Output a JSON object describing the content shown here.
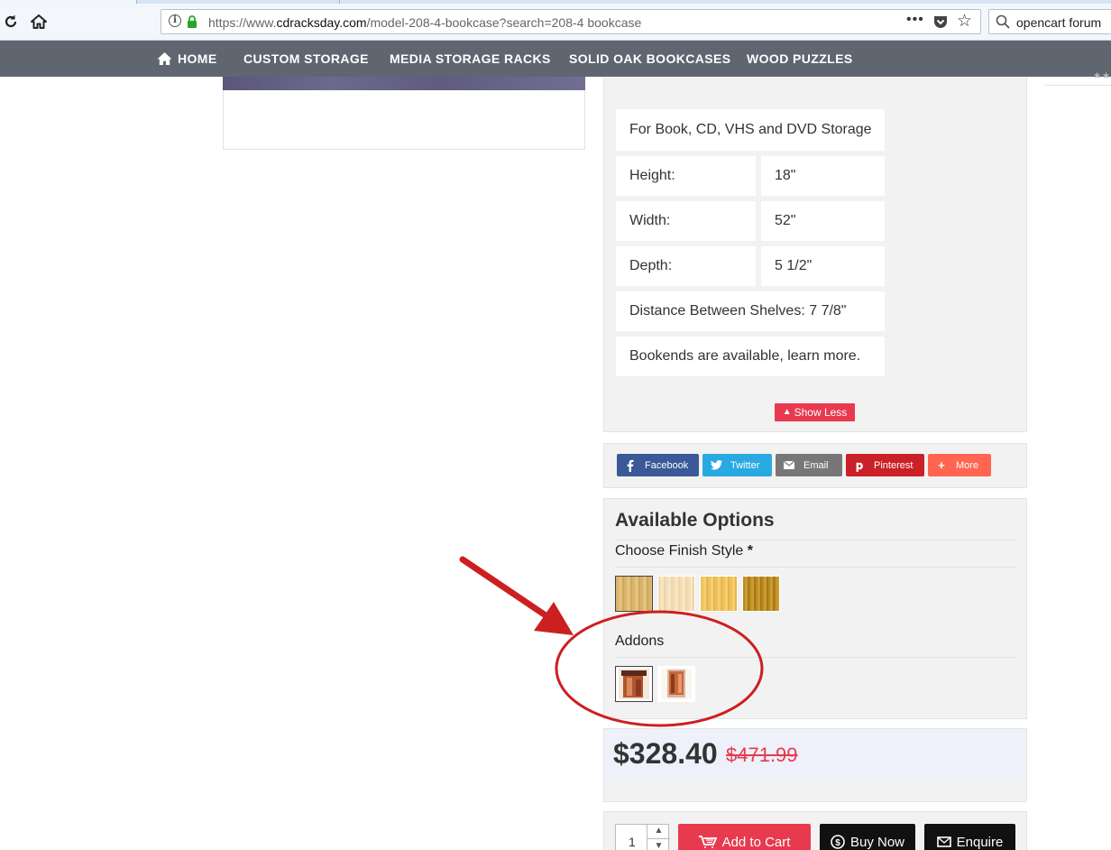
{
  "browser": {
    "url_prefix": "https://www.",
    "url_domain": "cdracksday.com",
    "url_path": "/model-208-4-bookcase?search=208-4 bookcase",
    "more_label": "•••",
    "search_value": "opencart forum"
  },
  "nav": {
    "items": [
      "HOME",
      "CUSTOM STORAGE",
      "MEDIA STORAGE RACKS",
      "SOLID OAK BOOKCASES",
      "WOOD PUZZLES"
    ]
  },
  "specs": {
    "storage": "For Book, CD, VHS and DVD Storage",
    "height_label": "Height:",
    "height_value": "18\"",
    "width_label": "Width:",
    "width_value": "52\"",
    "depth_label": "Depth:",
    "depth_value": "5 1/2\"",
    "shelves": "Distance Between Shelves: 7 7/8\"",
    "bookends": "Bookends are available, learn more.",
    "show_less": "Show Less"
  },
  "share": {
    "facebook": "Facebook",
    "twitter": "Twitter",
    "email": "Email",
    "pinterest": "Pinterest",
    "more": "More",
    "colors": {
      "facebook": "#3b5998",
      "twitter": "#29a9e1",
      "email": "#777777",
      "pinterest": "#cb2027",
      "more": "#ff6550"
    }
  },
  "options": {
    "title": "Available Options",
    "finish_label": "Choose Finish Style",
    "required_mark": "*",
    "addons_label": "Addons"
  },
  "price": {
    "current": "$328.40",
    "old": "$471.99"
  },
  "cart": {
    "quantity": "1",
    "add_to_cart": "Add to Cart",
    "buy_now": "Buy Now",
    "enquire": "Enquire",
    "colors": {
      "add_to_cart": "#e83a4f",
      "buy_now": "#111111",
      "enquire": "#111111"
    }
  },
  "annotation": {
    "color": "#cc1f1f"
  }
}
